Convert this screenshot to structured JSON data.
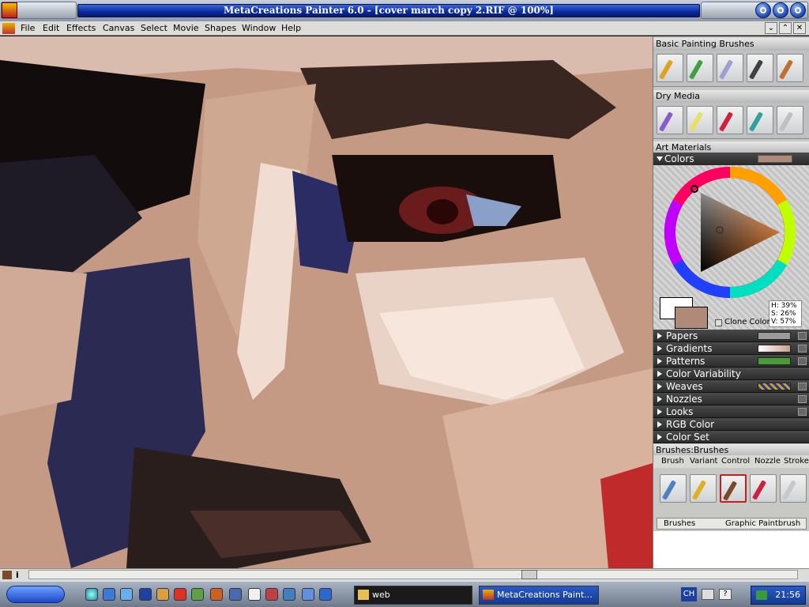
{
  "window": {
    "title": "MetaCreations Painter 6.0 - [cover march copy 2.RIF @ 100%]"
  },
  "menu": {
    "items": [
      "File",
      "Edit",
      "Effects",
      "Canvas",
      "Select",
      "Movie",
      "Shapes",
      "Window",
      "Help"
    ]
  },
  "palettes": {
    "basic_painting": {
      "title": "Basic Painting Brushes"
    },
    "dry_media": {
      "title": "Dry Media"
    },
    "art_materials": {
      "title": "Art Materials",
      "colors_label": "Colors",
      "hsv": {
        "h": "H: 39%",
        "s": "S: 26%",
        "v": "V: 57%"
      },
      "clone_color_label": "Clone Color",
      "current_color": "#b08a78",
      "sections": [
        {
          "label": "Papers",
          "swatch": "#9a9a9a"
        },
        {
          "label": "Gradients",
          "swatch": "#e8d0c0"
        },
        {
          "label": "Patterns",
          "swatch": "#4a9a3a"
        },
        {
          "label": "Color Variability",
          "swatch": ""
        },
        {
          "label": "Weaves",
          "swatch": "#2a3a8a"
        },
        {
          "label": "Nozzles",
          "swatch": ""
        },
        {
          "label": "Looks",
          "swatch": ""
        },
        {
          "label": "RGB Color",
          "swatch": ""
        },
        {
          "label": "Color Set",
          "swatch": ""
        }
      ]
    },
    "brushes": {
      "title": "Brushes:Brushes",
      "tabs": [
        "Brush",
        "Variant",
        "Control",
        "Nozzle",
        "Stroke"
      ],
      "category": "Brushes",
      "variant": "Graphic Paintbrush"
    }
  },
  "taskbar": {
    "tasks": [
      {
        "label": "web"
      },
      {
        "label": "MetaCreations Paint..."
      }
    ],
    "tray_lang": "CH",
    "clock": "21:56"
  },
  "icons": {
    "app": "painter-app-icon",
    "minimize": "minimize-icon",
    "maximize": "maximize-icon",
    "close": "close-icon"
  }
}
